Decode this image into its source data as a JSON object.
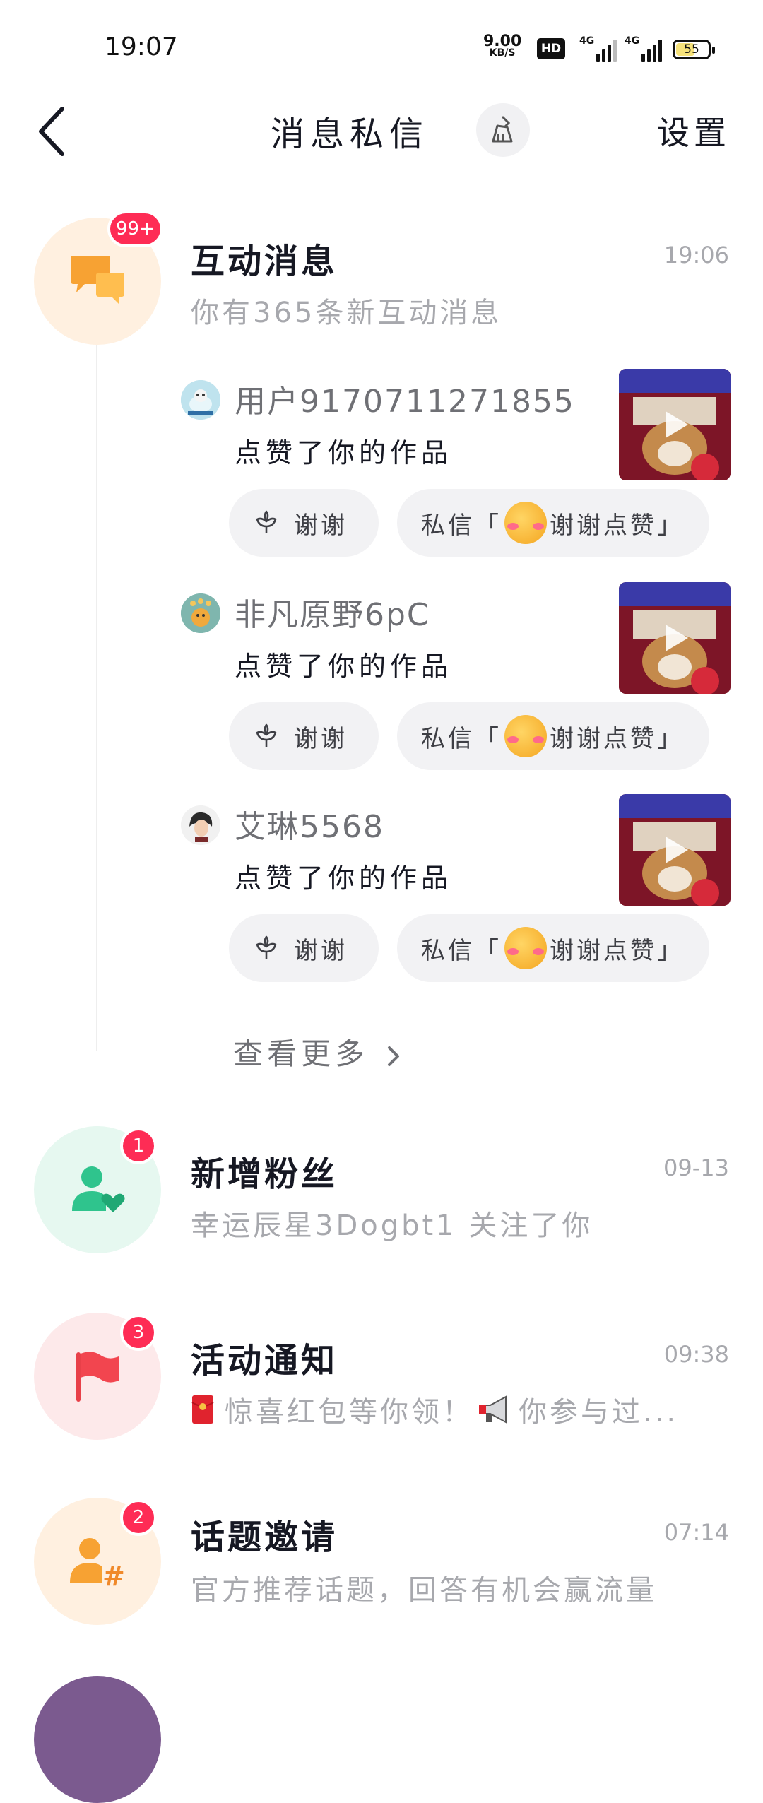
{
  "status_bar": {
    "time": "19:07",
    "net_speed": "9.00",
    "net_unit": "KB/S",
    "hd": "HD",
    "sig1": "4G",
    "sig2": "4G",
    "battery": "55"
  },
  "header": {
    "title": "消息私信",
    "settings_label": "设置"
  },
  "interactions": {
    "title": "互动消息",
    "badge": "99+",
    "time": "19:06",
    "subtitle": "你有365条新互动消息",
    "items": [
      {
        "name": "用户9170711271855",
        "action": "点赞了你的作品",
        "thanks_label": "谢谢",
        "dm_prefix": "私信「",
        "dm_text": "谢谢点赞",
        "dm_suffix": "」"
      },
      {
        "name": "非凡原野6pC",
        "action": "点赞了你的作品",
        "thanks_label": "谢谢",
        "dm_prefix": "私信「",
        "dm_text": "谢谢点赞",
        "dm_suffix": "」"
      },
      {
        "name": "艾琳5568",
        "action": "点赞了你的作品",
        "thanks_label": "谢谢",
        "dm_prefix": "私信「",
        "dm_text": "谢谢点赞",
        "dm_suffix": "」"
      }
    ],
    "see_more": "查看更多"
  },
  "rows": [
    {
      "title": "新增粉丝",
      "badge": "1",
      "time": "09-13",
      "subtitle": "幸运辰星3Dogbt1 关注了你",
      "icon": "person-heart-icon",
      "color": "#2fc48d"
    },
    {
      "title": "活动通知",
      "badge": "3",
      "time": "09:38",
      "subtitle_parts": [
        "惊喜红包等你领！",
        "你参与过..."
      ],
      "icon": "flag-icon",
      "color": "#f2454f"
    },
    {
      "title": "话题邀请",
      "badge": "2",
      "time": "07:14",
      "subtitle": "官方推荐话题，回答有机会赢流量",
      "icon": "person-hash-icon",
      "color": "#f7a233"
    }
  ],
  "colors": {
    "badge": "#fe2c55",
    "muted_text": "#a7a8ad",
    "pill_bg": "#f2f2f4"
  }
}
